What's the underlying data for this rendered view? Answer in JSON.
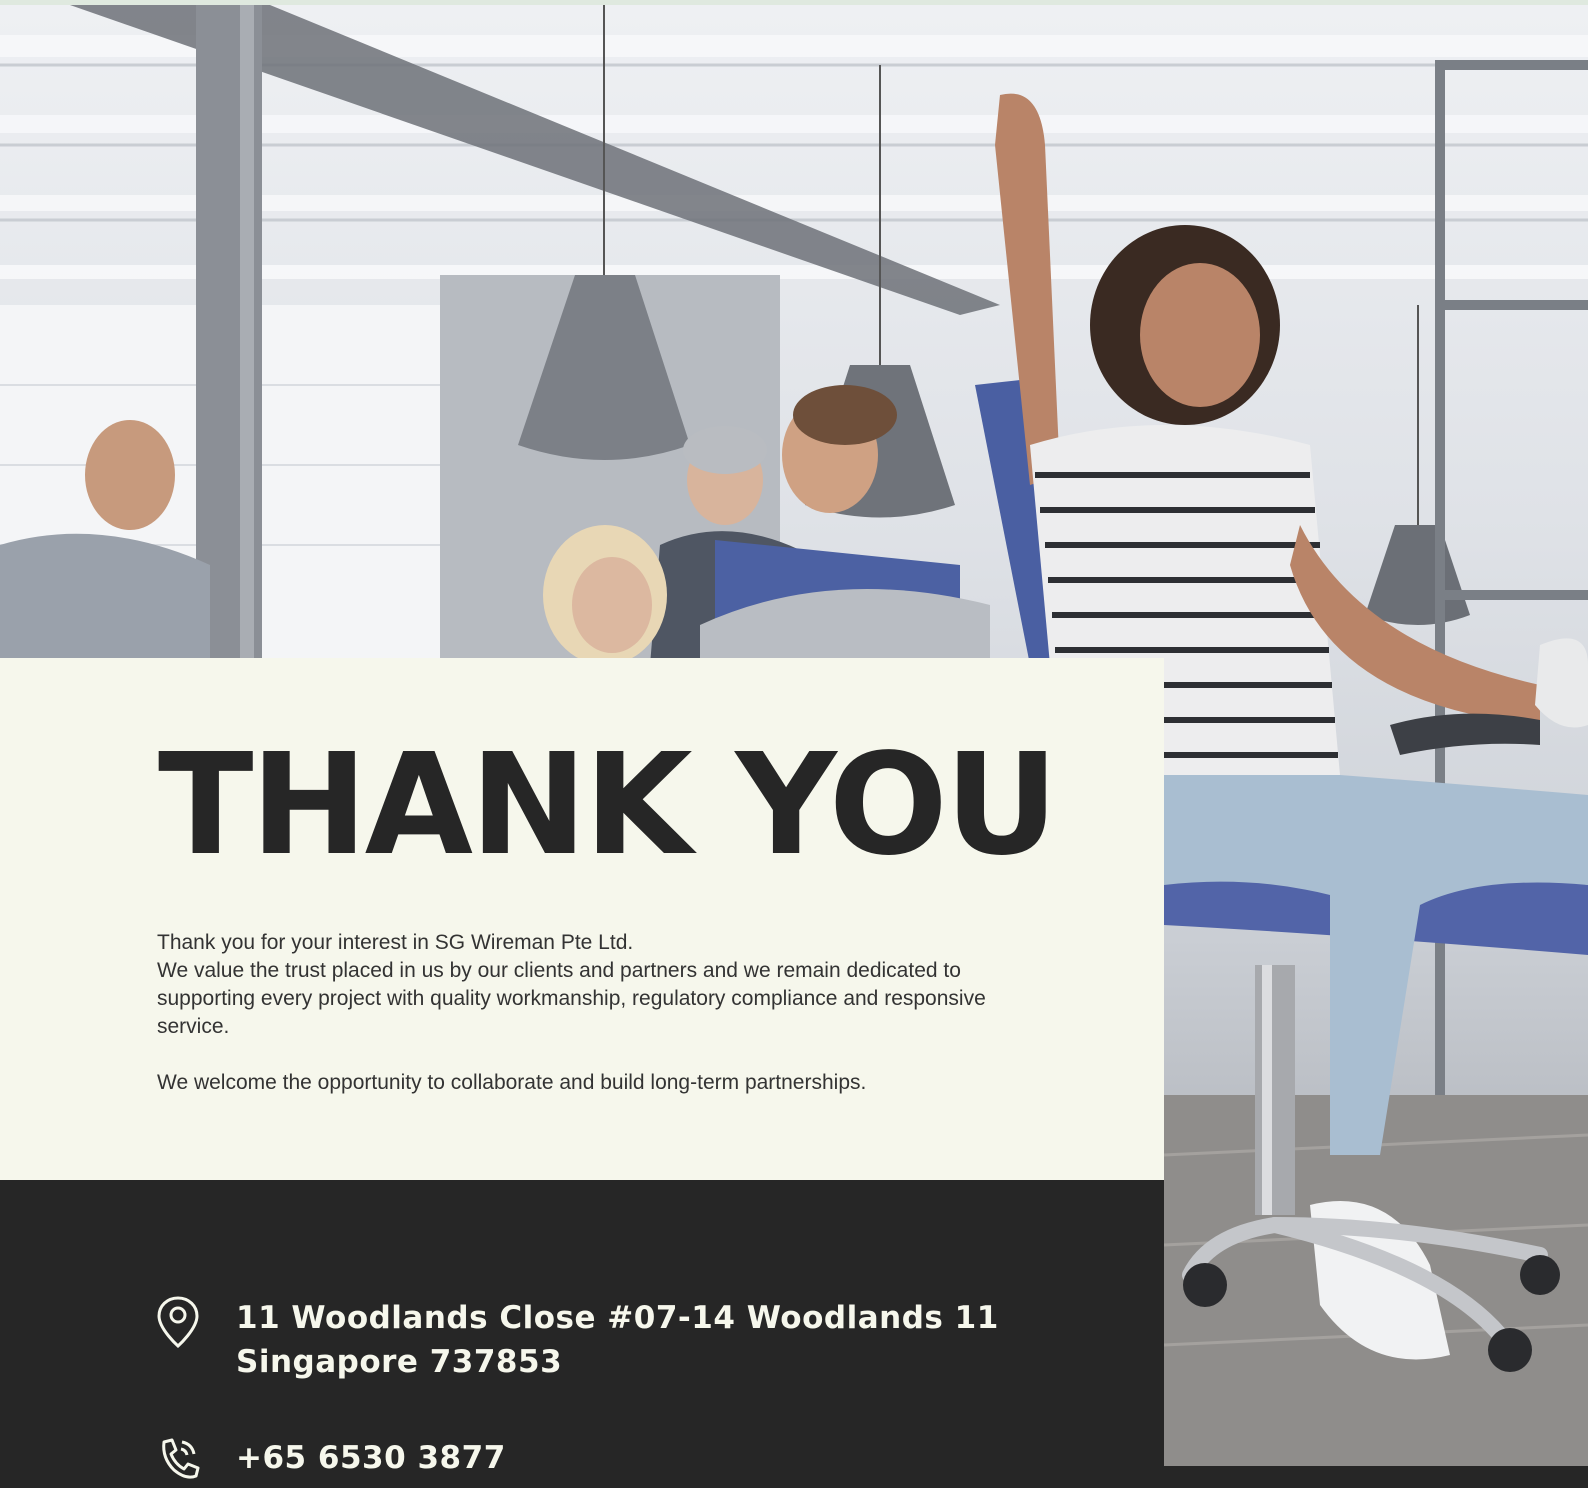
{
  "colors": {
    "cream": "#f6f7ec",
    "dark": "#262626",
    "text": "#333333"
  },
  "hero": {
    "title": "THANK YOU"
  },
  "message": {
    "lines": [
      "Thank you for your interest in SG Wireman Pte Ltd.",
      "We value the trust placed in us by our clients and partners and we remain dedicated to supporting every project with quality workmanship, regulatory compliance and responsive service."
    ],
    "closing": "We welcome the opportunity to collaborate and build long-term partnerships."
  },
  "contact": {
    "address_icon": "location-pin-icon",
    "address_line1": "11 Woodlands Close #07-14 Woodlands 11",
    "address_line2": "Singapore 737853",
    "phone_icon": "phone-icon",
    "phone": "+65 6530 3877"
  }
}
